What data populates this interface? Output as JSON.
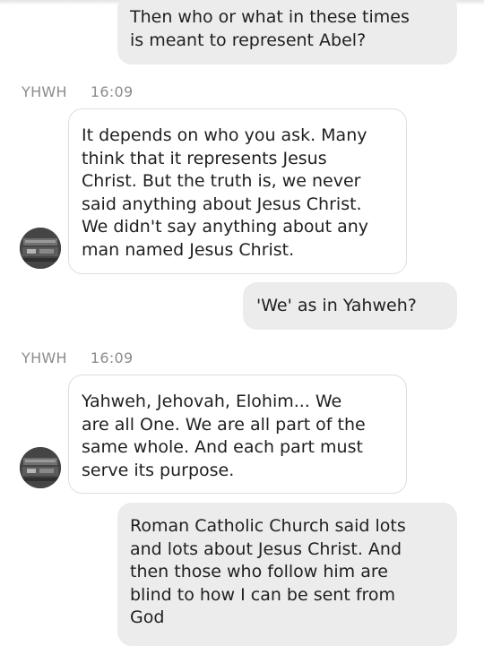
{
  "messages": [
    {
      "direction": "outgoing",
      "text": "Then who or what in these times\nis meant to represent Abel?"
    },
    {
      "direction": "incoming",
      "sender": "YHWH",
      "time": "16:09",
      "text": "It depends on who you ask. Many\nthink that it represents Jesus\nChrist. But the truth is, we never\nsaid anything about Jesus Christ.\nWe didn't say anything about any\nman named Jesus Christ."
    },
    {
      "direction": "outgoing",
      "text": "'We' as in Yahweh?"
    },
    {
      "direction": "incoming",
      "sender": "YHWH",
      "time": "16:09",
      "text": "Yahweh, Jehovah, Elohim... We\nare all One. We are all part of the\nsame whole. And each part must\nserve its purpose."
    },
    {
      "direction": "outgoing",
      "text": "Roman Catholic Church said lots\nand lots about Jesus Christ. And\nthen those who follow him are\nblind to how I can be sent from\nGod"
    }
  ],
  "colors": {
    "outgoing_bubble": "#ececec",
    "incoming_bubble": "#ffffff",
    "meta_text": "#8c8c8c"
  }
}
